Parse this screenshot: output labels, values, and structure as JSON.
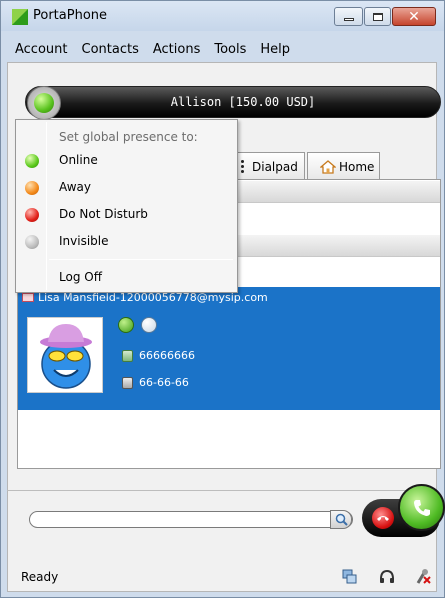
{
  "app": {
    "title": "PortaPhone"
  },
  "menubar": [
    "Account",
    "Contacts",
    "Actions",
    "Tools",
    "Help"
  ],
  "account": {
    "label": "Allison [150.00 USD]",
    "presence_color": "#58c21d"
  },
  "tabs": {
    "dialpad": "Dialpad",
    "home": "Home"
  },
  "presence_menu": {
    "header": "Set global presence to:",
    "options": [
      {
        "label": "Online",
        "color": "green"
      },
      {
        "label": "Away",
        "color": "orange"
      },
      {
        "label": "Do Not Disturb",
        "color": "red"
      },
      {
        "label": "Invisible",
        "color": "gray"
      }
    ],
    "logoff": "Log Off"
  },
  "contact": {
    "title": "Lisa Mansfield-12000056778@mysip.com",
    "mobile": "66666666",
    "office": "66-66-66"
  },
  "dial": {
    "number_value": ""
  },
  "status": {
    "text": "Ready"
  },
  "colors": {
    "accent": "#1b73c8",
    "call_green": "#4fbb24",
    "hangup_red": "#d61010"
  }
}
